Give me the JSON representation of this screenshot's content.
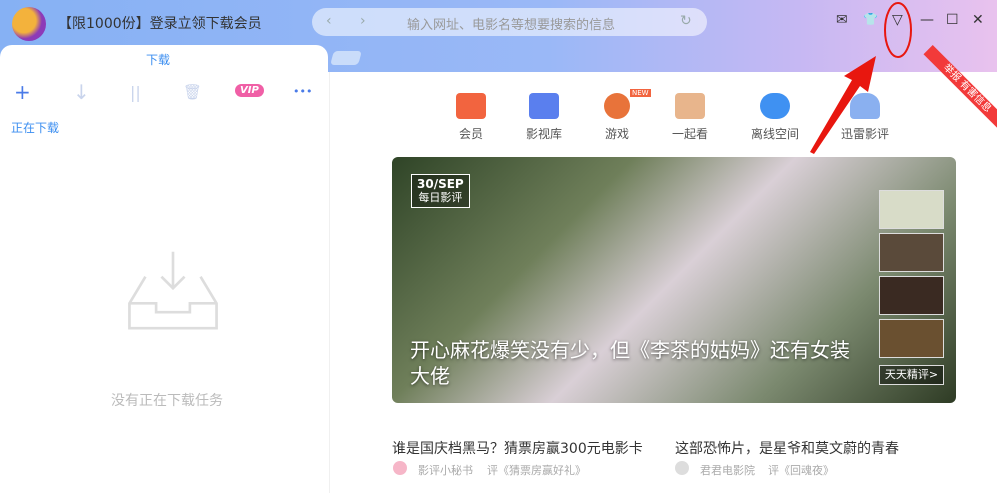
{
  "titlebar": {
    "promo": "【限1000份】登录立领下载会员",
    "address_placeholder": "输入网址、电影名等想要搜索的信息",
    "back": "‹",
    "forward": "›",
    "refresh": "↻",
    "mail": "✉",
    "shirt": "👕",
    "menu": "▽",
    "minimize": "—",
    "maximize": "☐",
    "close": "✕"
  },
  "tab": {
    "label": "下载"
  },
  "toolbar": {
    "add": "+",
    "download": "↓",
    "pause": "||",
    "delete": "🗑",
    "vip": "VIP",
    "more": "•••"
  },
  "left": {
    "section": "正在下载",
    "empty": "没有正在下载任务"
  },
  "nav": [
    {
      "label": "会员",
      "color": "#f2643f"
    },
    {
      "label": "影视库",
      "color": "#5a7fee"
    },
    {
      "label": "游戏",
      "color": "#e8733a",
      "badge": "NEW"
    },
    {
      "label": "一起看",
      "color": "#e8b58c"
    },
    {
      "label": "离线空间",
      "color": "#3f91f2"
    },
    {
      "label": "迅雷影评",
      "color": "#8ab0f0"
    }
  ],
  "ribbon": "举报 有害信息",
  "banner": {
    "date": "30/SEP",
    "date_sub": "每日影评",
    "headline": "开心麻花爆笑没有少，但《李茶的姑妈》还有女装大佬",
    "more": "天天精评>"
  },
  "articles": [
    {
      "title": "谁是国庆档黑马？猜票房赢300元电影卡",
      "author": "影评小秘书",
      "review": "评《猜票房赢好礼》"
    },
    {
      "title": "这部恐怖片，是星爷和莫文蔚的青春",
      "author": "君君电影院",
      "review": "评《回魂夜》"
    }
  ]
}
